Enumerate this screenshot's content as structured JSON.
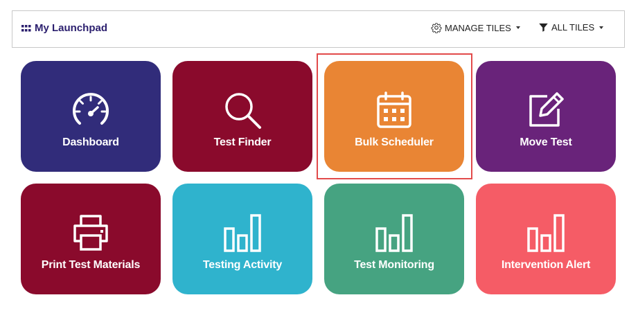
{
  "header": {
    "title": "My Launchpad",
    "manage_label": "MANAGE TILES",
    "filter_label": "ALL TILES"
  },
  "tiles": [
    {
      "label": "Dashboard",
      "icon": "speedometer-icon",
      "color": "#312c7a"
    },
    {
      "label": "Test Finder",
      "icon": "search-icon",
      "color": "#8a0a2c"
    },
    {
      "label": "Bulk Scheduler",
      "icon": "calendar-icon",
      "color": "#e98534",
      "selected": true
    },
    {
      "label": "Move Test",
      "icon": "edit-icon",
      "color": "#69237a"
    },
    {
      "label": "Print Test Materials",
      "icon": "printer-icon",
      "color": "#8a0a2c"
    },
    {
      "label": "Testing Activity",
      "icon": "bar-chart-icon",
      "color": "#2fb3cd"
    },
    {
      "label": "Test Monitoring",
      "icon": "bar-chart-icon",
      "color": "#46a381"
    },
    {
      "label": "Intervention Alert",
      "icon": "bar-chart-icon",
      "color": "#f55c66"
    }
  ],
  "colors": {
    "title": "#2b1f6e",
    "highlight_border": "#e24a4a"
  }
}
